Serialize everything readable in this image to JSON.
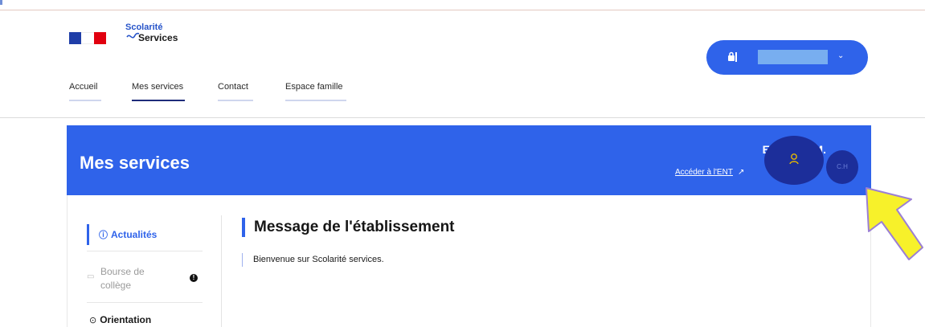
{
  "header": {
    "logo": {
      "line1": "Scolarité",
      "line2": "Services"
    },
    "nav": [
      {
        "label": "Accueil",
        "active": false
      },
      {
        "label": "Mes services",
        "active": true
      },
      {
        "label": "Contact",
        "active": false
      },
      {
        "label": "Espace famille",
        "active": false
      }
    ],
    "login": {
      "lock_icon": "lock-icon",
      "chevron_icon": "chevron-down-icon"
    }
  },
  "banner": {
    "title": "Mes services",
    "user_name": "Eléonore M.",
    "ent_link": "Accéder à l'ENT",
    "avatar_initials": "C.H"
  },
  "sidebar": {
    "items": [
      {
        "label": "Actualités",
        "icon": "info-circle-icon",
        "state": "active"
      },
      {
        "label": "Bourse de collège",
        "icon": "wallet-icon",
        "state": "disabled",
        "badge": "!"
      },
      {
        "label": "Orientation",
        "icon": "compass-icon",
        "state": "normal"
      }
    ]
  },
  "main": {
    "heading": "Message de l'établissement",
    "message": "Bienvenue sur Scolarité services."
  },
  "colors": {
    "primary": "#2f63ea",
    "dark_blue": "#1c2e9a",
    "flag_blue": "#1f3ea8",
    "flag_red": "#e1000f",
    "annotation_arrow": "#f7f12a"
  }
}
